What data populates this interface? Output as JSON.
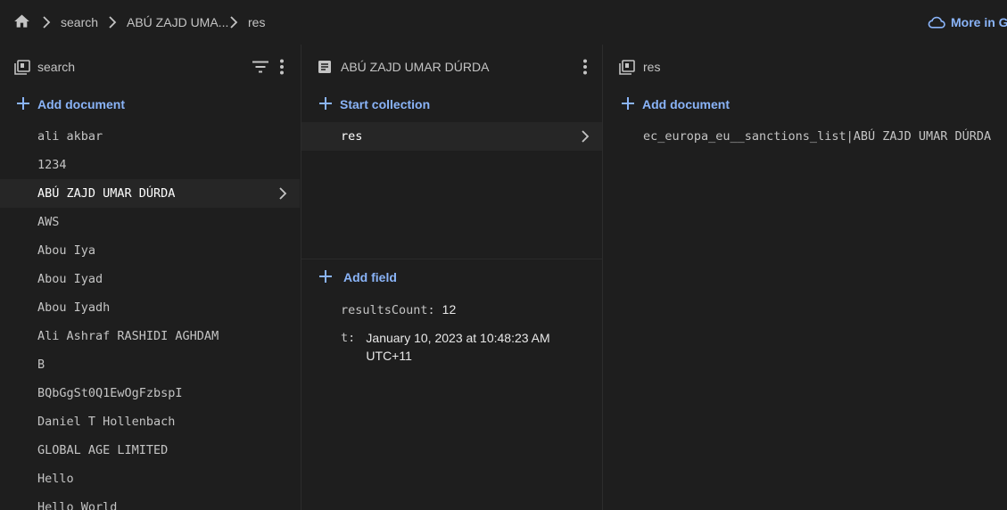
{
  "breadcrumb": {
    "items": [
      "search",
      "ABÚ ZAJD UMA...",
      "res"
    ],
    "more_label": "More in G"
  },
  "collection_panel": {
    "title": "search",
    "add_label": "Add document",
    "items": [
      "ali akbar",
      "1234",
      "ABÚ ZAJD UMAR DÚRDA",
      "AWS",
      "Abou Iya",
      "Abou Iyad",
      "Abou Iyadh",
      "Ali Ashraf RASHIDI AGHDAM",
      "B",
      "BQbGgSt0Q1EwOgFzbspI",
      "Daniel T Hollenbach",
      "GLOBAL AGE LIMITED",
      "Hello",
      "Hello World"
    ],
    "selected_index": 2
  },
  "document_panel": {
    "title": "ABÚ ZAJD UMAR DÚRDA",
    "start_collection_label": "Start collection",
    "subcollections": [
      "res"
    ],
    "add_field_label": "Add field",
    "fields": [
      {
        "key": "resultsCount:",
        "value": "12"
      },
      {
        "key": "t:",
        "value_line1": "January 10, 2023 at 10:48:23 AM",
        "value_line2": "UTC+11"
      }
    ]
  },
  "subcollection_panel": {
    "title": "res",
    "add_label": "Add document",
    "items": [
      "ec_europa_eu__sanctions_list|ABÚ ZAJD UMAR DÚRDA"
    ]
  },
  "colors": {
    "background": "#1e1e1e",
    "accent": "#8ab4f8",
    "text": "#c4c4c4"
  },
  "icons": [
    "home-icon",
    "chevron-right-icon",
    "cloud-icon",
    "collection-icon",
    "filter-icon",
    "more-vert-icon",
    "document-icon",
    "plus-icon"
  ]
}
